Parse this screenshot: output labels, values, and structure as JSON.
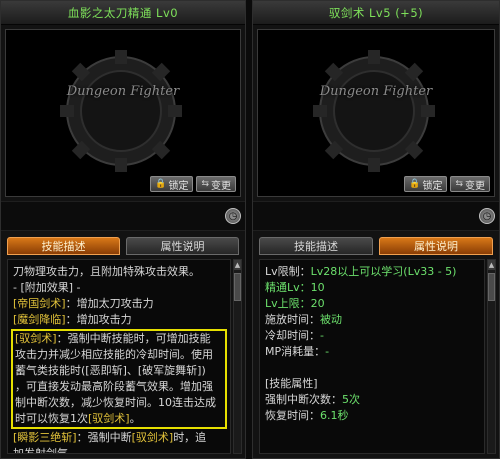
{
  "left": {
    "title": "血影之太刀精通 Lv0",
    "watermark": "Dungeon Fighter",
    "buttons": {
      "lock": "锁定",
      "transfer": "变更"
    },
    "tabs": {
      "desc": "技能描述",
      "attr": "属性说明"
    },
    "content": {
      "intro": "刀物理攻击力，且附加特殊攻击效果。",
      "extra_header": "- [附加效果] -",
      "item1_name": "[帝国剑术]",
      "item1_text": "：增加太刀攻击力",
      "item2_name": "[魔剑降临]",
      "item2_text": "：增加攻击力",
      "hl_l1_name": "[驭剑术]",
      "hl_l1_text": "：强制中断技能时，可增加技能",
      "hl_l2": "攻击力并减少相应技能的冷却时间。使用",
      "hl_l3": "蓄气类技能时([恶即斩]、[破军旋舞斩])",
      "hl_l4": "，可直接发动最高阶段蓄气效果。增加强",
      "hl_l5": "制中断次数，减少恢复时间。10连击达成",
      "hl_l6_a": "时可以恢复1次",
      "hl_l6_b": "[驭剑术]",
      "hl_l6_c": "。",
      "item4_name": "[瞬影三绝斩]",
      "item4_text_a": "：强制中断",
      "item4_text_b": "[驭剑术]",
      "item4_text_c": "时，追",
      "item4_l2": "加发射剑气。"
    }
  },
  "right": {
    "title": "驭剑术 Lv5 (+5)",
    "watermark": "Dungeon Fighter",
    "buttons": {
      "lock": "锁定",
      "transfer": "变更"
    },
    "tabs": {
      "desc": "技能描述",
      "attr": "属性说明"
    },
    "content": {
      "lv_limit_label": "Lv限制：",
      "lv_limit_value": "Lv28以上可以学习(Lv33 - 5)",
      "master_label": "精通Lv：",
      "master_value": "10",
      "max_label": "Lv上限：",
      "max_value": "20",
      "cast_label": "施放时间：",
      "cast_value": "被动",
      "cd_label": "冷却时间：",
      "cd_value": "-",
      "mp_label": "MP消耗量：",
      "mp_value": "-",
      "attr_header": "[技能属性]",
      "force_label": "强制中断次数：",
      "force_value": "5次",
      "recover_label": "恢复时间：",
      "recover_value": "6.1秒"
    }
  }
}
